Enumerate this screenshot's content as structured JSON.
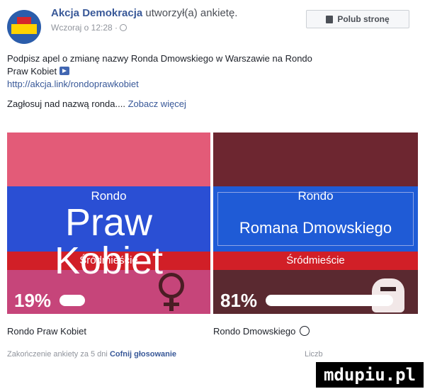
{
  "header": {
    "page_name": "Akcja Demokracja",
    "action": "utworzył(a) ankietę.",
    "time": "Wczoraj o 12:28 ·",
    "like_button": "Polub stronę"
  },
  "post": {
    "line1": "Podpisz apel o zmianę nazwy Ronda Dmowskiego w Warszawie na Rondo",
    "line2": "Praw Kobiet",
    "link": "http://akcja.link/rondoprawkobiet",
    "vote_text": "Zagłosuj nad nazwą ronda....",
    "more": "Zobacz więcej"
  },
  "poll": {
    "options": [
      {
        "sign_top": "Rondo",
        "sign_name": "Praw Kobiet",
        "sign_district": "Śródmieście",
        "percent_text": "19%",
        "percent": 19,
        "label": "Rondo Praw Kobiet"
      },
      {
        "sign_top": "Rondo",
        "sign_name": "Romana Dmowskiego",
        "sign_district": "Śródmieście",
        "percent_text": "81%",
        "percent": 81,
        "label": "Rondo Dmowskiego"
      }
    ],
    "colors": {
      "left_bg": "#e9506f",
      "right_bg": "#6b2730",
      "sign_blue": "#1f5bd6",
      "sign_red": "#d11f27"
    }
  },
  "footer": {
    "ends": "Zakończenie ankiety za 5 dni",
    "undo": "Cofnij głosowanie",
    "count": "Liczb"
  },
  "watermark": "mdupiu.pl",
  "icons": [
    "akcja-logo",
    "globe-icon",
    "like-thumb-icon",
    "arrow-icon",
    "venus-fist-icon",
    "portrait-icon",
    "checkmark-icon"
  ]
}
